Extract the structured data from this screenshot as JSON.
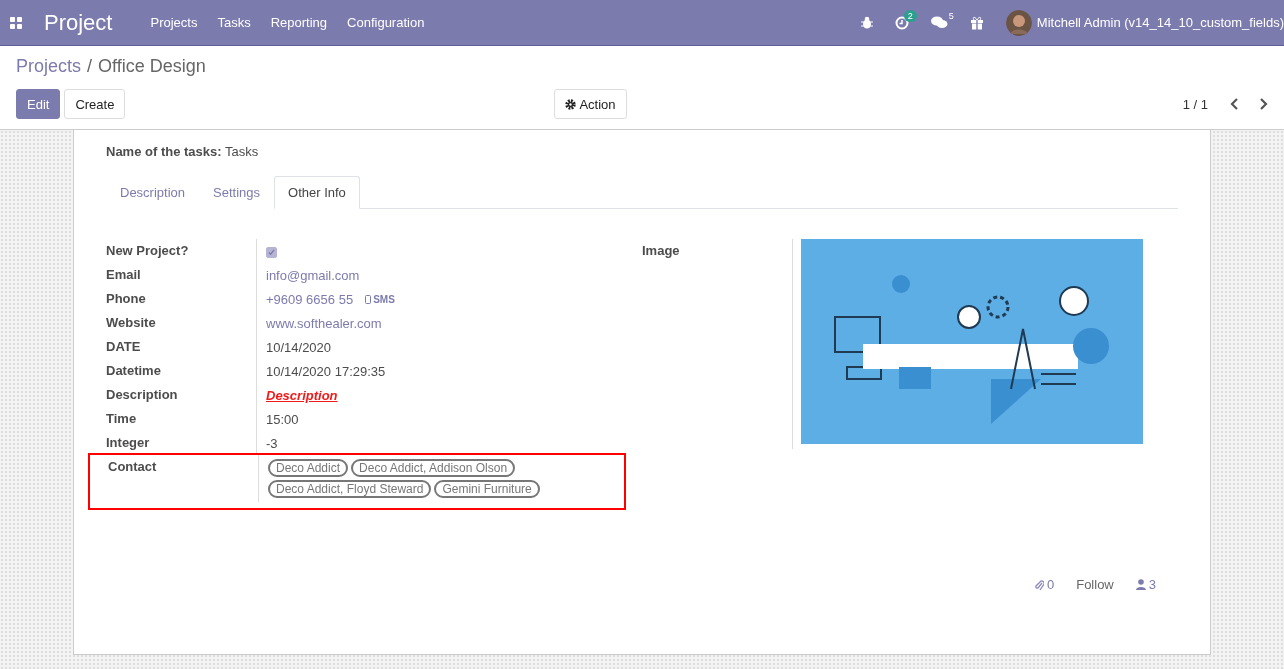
{
  "navbar": {
    "app_name": "Project",
    "menu": [
      "Projects",
      "Tasks",
      "Reporting",
      "Configuration"
    ],
    "activity_count": "2",
    "message_count": "5",
    "user": "Mitchell Admin (v14_14_10_custom_fields)"
  },
  "breadcrumb_separator": "/",
  "breadcrumb": [
    {
      "label": "Projects",
      "kind": "link"
    },
    {
      "label": "Office Design",
      "kind": "current"
    }
  ],
  "buttons": {
    "edit": "Edit",
    "create": "Create",
    "action": "Action"
  },
  "pager": "1 / 1",
  "form": {
    "task_name_label": "Name of the tasks:",
    "task_name_value": "Tasks",
    "tabs": [
      {
        "label": "Description",
        "selected": false
      },
      {
        "label": "Settings",
        "selected": false
      },
      {
        "label": "Other Info",
        "selected": true
      }
    ],
    "fields": [
      {
        "label": "New Project?",
        "kind": "checkbox",
        "checked": true
      },
      {
        "label": "Email",
        "kind": "link",
        "value": "info@gmail.com"
      },
      {
        "label": "Phone",
        "kind": "phone",
        "value": "+9609 6656 55",
        "action": "SMS"
      },
      {
        "label": "Website",
        "kind": "link",
        "value": "www.softhealer.com"
      },
      {
        "label": "DATE",
        "kind": "text",
        "value": "10/14/2020"
      },
      {
        "label": "Datetime",
        "kind": "text",
        "value": "10/14/2020 17:29:35"
      },
      {
        "label": "Description",
        "kind": "html",
        "value": "Description"
      },
      {
        "label": "Time",
        "kind": "text",
        "value": "15:00"
      },
      {
        "label": "Integer",
        "kind": "text",
        "value": "-3"
      },
      {
        "label": "Contact",
        "kind": "tags",
        "tags": [
          "Deco Addict",
          "Deco Addict, Addison Olson",
          "Deco Addict, Floyd Steward",
          "Gemini Furniture"
        ],
        "highlighted": true
      }
    ],
    "image_label": "Image"
  },
  "chatter": {
    "attachments": "0",
    "follow": "Follow",
    "followers": "3"
  }
}
